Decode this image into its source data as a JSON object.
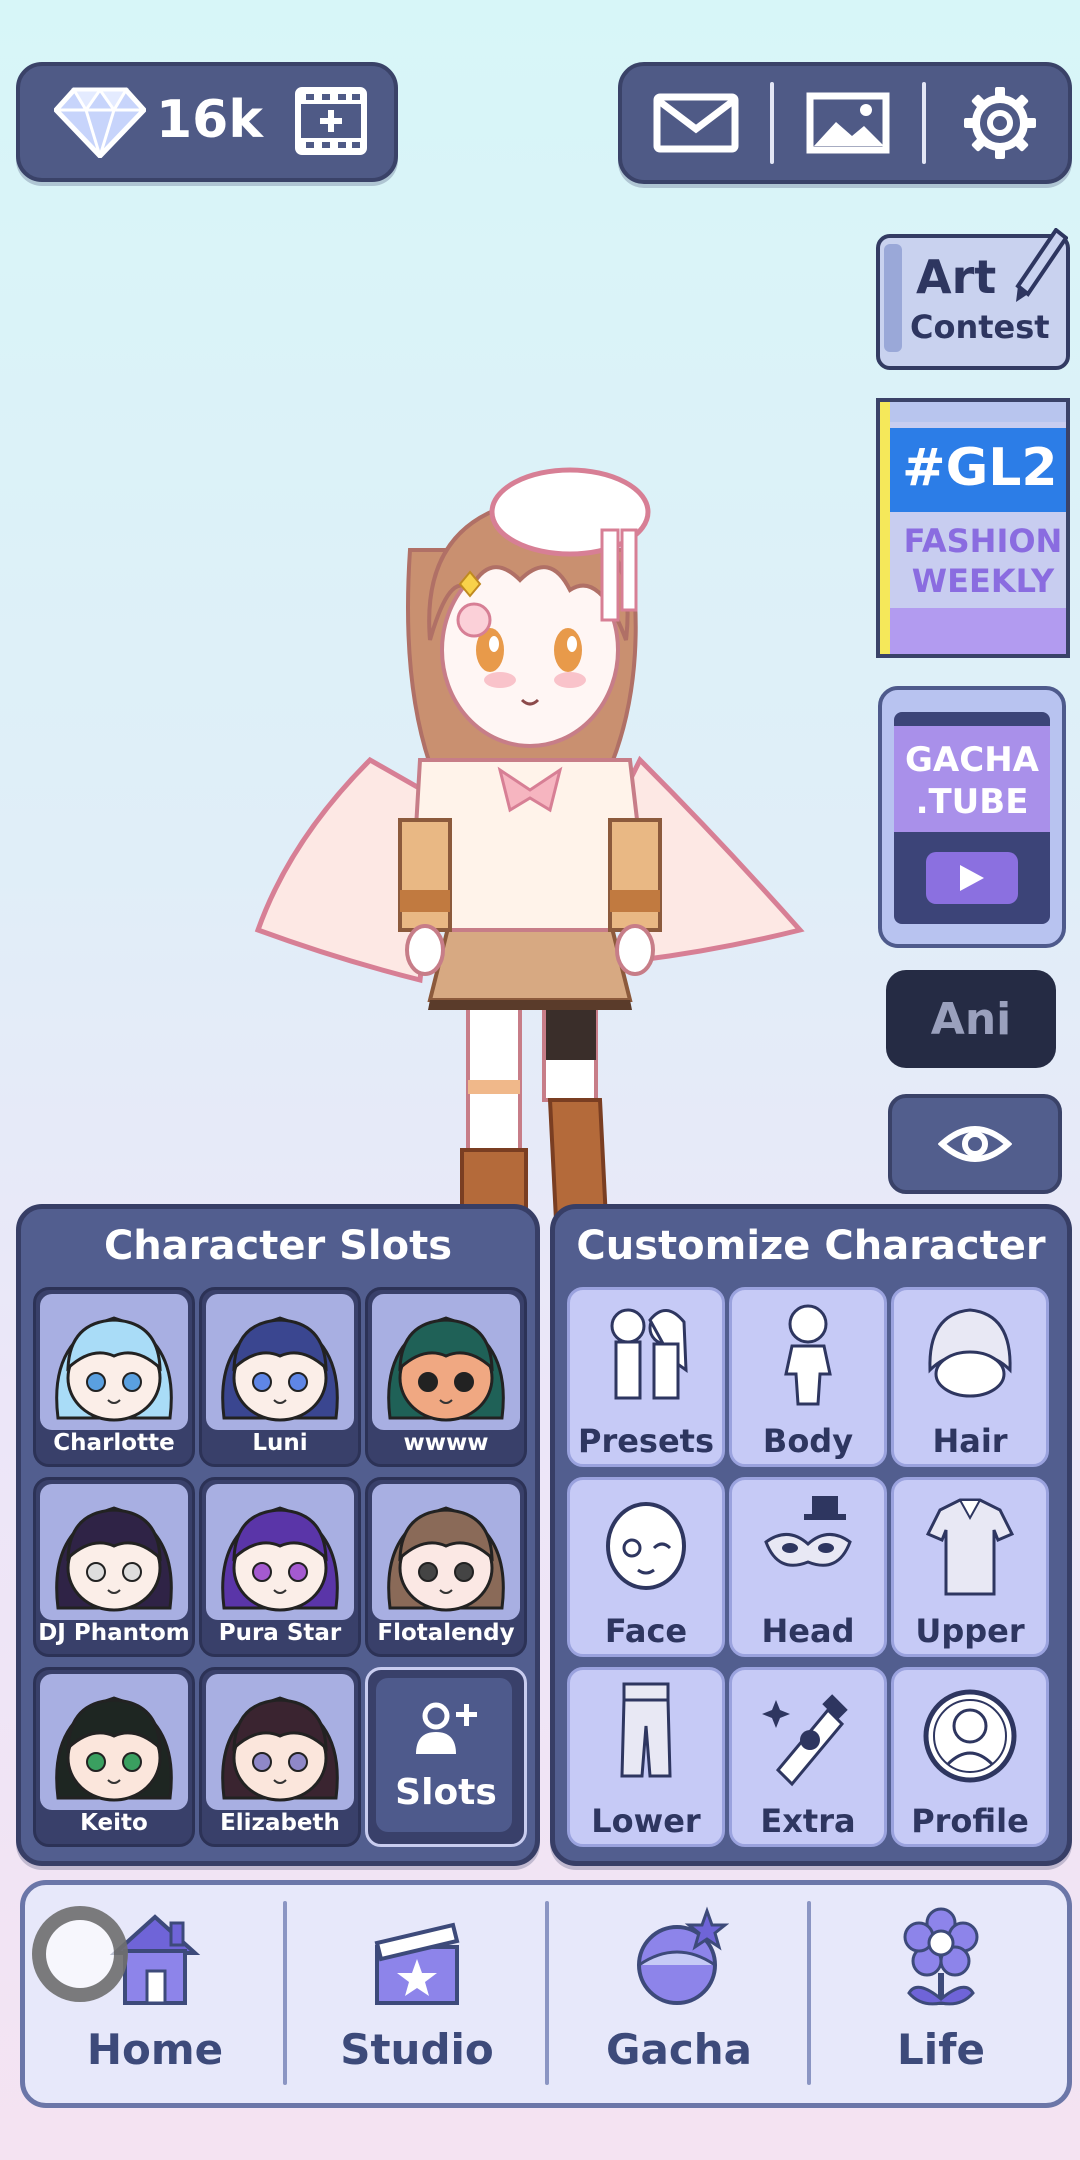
{
  "header": {
    "currency": {
      "icon": "diamond-icon",
      "value": "16k"
    },
    "buttons": [
      "film-add-icon",
      "mail-icon",
      "image-icon",
      "gear-icon"
    ]
  },
  "side": {
    "art_contest": {
      "line1": "Art",
      "line2": "Contest"
    },
    "gl2": {
      "title": "#GL2",
      "line1": "FASHION",
      "line2": "WEEKLY"
    },
    "gacha_tube": {
      "line1": "GACHA",
      "line2": ".TUBE"
    },
    "ani_label": "Ani"
  },
  "character_slots": {
    "title": "Character Slots",
    "slots": [
      {
        "name": "Charlotte",
        "hair": "#a9dcf7",
        "skin": "#fbeee8",
        "eyes": "#5aa0e0"
      },
      {
        "name": "Luni",
        "hair": "#3a4690",
        "skin": "#fbeee8",
        "eyes": "#5f86e6"
      },
      {
        "name": "wwww",
        "hair": "#1f6157",
        "skin": "#f0a882",
        "eyes": "#222222"
      },
      {
        "name": "DJ Phantom",
        "hair": "#2f2346",
        "skin": "#fbeee8",
        "eyes": "#dddddd"
      },
      {
        "name": "Pura Star",
        "hair": "#5a35a8",
        "skin": "#fbeee8",
        "eyes": "#a45ad0"
      },
      {
        "name": "Flotalendy",
        "hair": "#8a6a58",
        "skin": "#fbe8e4",
        "eyes": "#444444"
      },
      {
        "name": "Keito",
        "hair": "#1e2622",
        "skin": "#fbe6dc",
        "eyes": "#3aa060"
      },
      {
        "name": "Elizabeth",
        "hair": "#3a2430",
        "skin": "#fbe6dc",
        "eyes": "#8f88c8"
      }
    ],
    "add_label": "Slots"
  },
  "customize": {
    "title": "Customize Character",
    "items": [
      {
        "label": "Presets",
        "icon": "presets-icon"
      },
      {
        "label": "Body",
        "icon": "body-icon"
      },
      {
        "label": "Hair",
        "icon": "hair-icon"
      },
      {
        "label": "Face",
        "icon": "face-icon"
      },
      {
        "label": "Head",
        "icon": "head-icon"
      },
      {
        "label": "Upper",
        "icon": "upper-icon"
      },
      {
        "label": "Lower",
        "icon": "lower-icon"
      },
      {
        "label": "Extra",
        "icon": "extra-icon"
      },
      {
        "label": "Profile",
        "icon": "profile-icon"
      }
    ]
  },
  "nav": {
    "items": [
      {
        "label": "Home",
        "icon": "house-icon"
      },
      {
        "label": "Studio",
        "icon": "clapperboard-icon"
      },
      {
        "label": "Gacha",
        "icon": "gacha-orb-icon"
      },
      {
        "label": "Life",
        "icon": "flower-icon"
      }
    ]
  }
}
